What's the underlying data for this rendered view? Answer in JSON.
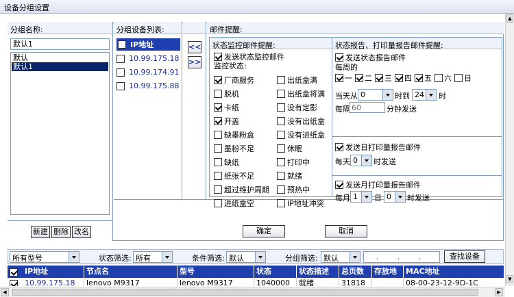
{
  "window": {
    "title": "设备分组设置"
  },
  "group_panel": {
    "header": "分组名称:",
    "name_value": "默认1",
    "list": [
      {
        "label": "默认",
        "selected": false
      },
      {
        "label": "默认1",
        "selected": true
      }
    ],
    "buttons": {
      "new": "新建",
      "delete": "删除",
      "rename": "改名"
    }
  },
  "device_panel": {
    "header": "分组设备列表:",
    "column": "IP地址",
    "items": [
      "10.99.175.18",
      "10.99.174.91",
      "10.99.175.88"
    ],
    "move_left": "<<",
    "move_right": ">>"
  },
  "mail_panel": {
    "header": "邮件提醒:",
    "status": {
      "header": "状态监控邮件提醒:",
      "send_label": "发送状态监控邮件",
      "monitor_label": "监控状态:",
      "left": [
        {
          "label": "厂商服务",
          "checked": true
        },
        {
          "label": "脱机",
          "checked": false
        },
        {
          "label": "卡纸",
          "checked": true
        },
        {
          "label": "开盖",
          "checked": true
        },
        {
          "label": "缺墨粉盒",
          "checked": false
        },
        {
          "label": "墨粉不足",
          "checked": false
        },
        {
          "label": "缺纸",
          "checked": false
        },
        {
          "label": "纸张不足",
          "checked": false
        },
        {
          "label": "超过维护周期",
          "checked": false
        },
        {
          "label": "进纸盒空",
          "checked": false
        }
      ],
      "right": [
        {
          "label": "出纸盒满",
          "checked": false
        },
        {
          "label": "出纸盒将满",
          "checked": false
        },
        {
          "label": "没有定影",
          "checked": false
        },
        {
          "label": "没有出纸盒",
          "checked": false
        },
        {
          "label": "没有进纸盒",
          "checked": false
        },
        {
          "label": "休眠",
          "checked": false
        },
        {
          "label": "打印中",
          "checked": false
        },
        {
          "label": "就绪",
          "checked": false
        },
        {
          "label": "预热中",
          "checked": false
        },
        {
          "label": "IP地址冲突",
          "checked": false
        }
      ]
    },
    "report": {
      "header": "状态报告、打印量报告邮件提醒:",
      "status_report": {
        "label": "发送状态报告邮件",
        "weekly_label": "每周的",
        "days": [
          {
            "label": "一",
            "checked": true
          },
          {
            "label": "二",
            "checked": true
          },
          {
            "label": "三",
            "checked": true
          },
          {
            "label": "四",
            "checked": true
          },
          {
            "label": "五",
            "checked": true
          },
          {
            "label": "六",
            "checked": false
          },
          {
            "label": "日",
            "checked": false
          }
        ],
        "from_label": "当天从",
        "from_value": "0",
        "to_label": "时到",
        "to_value": "24",
        "hour_label": "时",
        "every_label": "每隔",
        "every_value": "60",
        "minutes_label": "分钟发送"
      },
      "daily": {
        "label": "发送日打印量报告邮件",
        "prefix": "每天",
        "value": "0",
        "suffix": "时发送"
      },
      "monthly": {
        "label": "发送月打印量报告邮件",
        "prefix": "每月",
        "day_value": "1",
        "day_label": "日",
        "hour_value": "0",
        "suffix": "时发送"
      }
    },
    "ok": "确定",
    "cancel": "取消"
  },
  "filter_bar": {
    "model": "所有型号",
    "status_label": "状态筛选:",
    "status_value": "所有",
    "condition_label": "条件筛选:",
    "condition_value": "默认",
    "group_label": "分组筛选:",
    "group_value": "默认",
    "ip_placeholder": ". . .",
    "find": "查找设备"
  },
  "table": {
    "columns": [
      "IP地址",
      "节点名",
      "型号",
      "状态",
      "状态描述",
      "总页数",
      "存放地",
      "MAC地址"
    ],
    "rows": [
      [
        "10.99.175.18",
        "lenovo M9317",
        "lenovo M9317",
        "1040000",
        "就绪",
        "31818",
        "",
        "08-00-23-12-9D-1C"
      ]
    ]
  },
  "colors": {
    "header_blue": "#1f3fae",
    "accent": "#1a2f9e",
    "selected": "#0a246a"
  }
}
